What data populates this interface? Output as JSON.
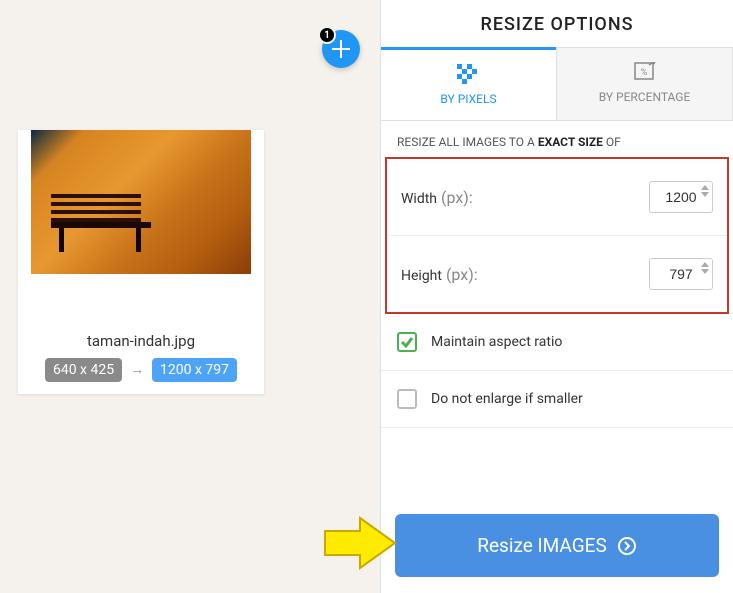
{
  "add_button": {
    "badge_count": "1"
  },
  "image": {
    "filename": "taman-indah.jpg",
    "original_dims": "640 x 425",
    "new_dims": "1200 x 797"
  },
  "panel": {
    "title": "RESIZE OPTIONS",
    "tabs": {
      "pixels": "BY PIXELS",
      "percentage": "BY PERCENTAGE"
    },
    "subtitle_prefix": "RESIZE ALL IMAGES TO A ",
    "subtitle_strong": "EXACT SIZE",
    "subtitle_suffix": " OF",
    "width_label": "Width",
    "height_label": "Height",
    "unit": "(px):",
    "width_value": "1200",
    "height_value": "797",
    "maintain_ratio": "Maintain aspect ratio",
    "no_enlarge": "Do not enlarge if smaller",
    "resize_button": "Resize IMAGES"
  }
}
